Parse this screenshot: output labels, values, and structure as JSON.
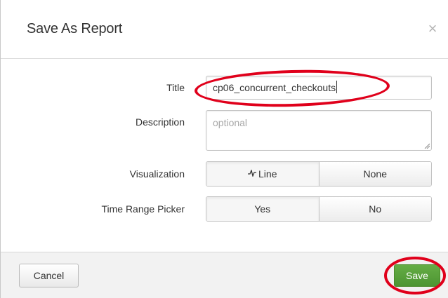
{
  "dialog": {
    "title": "Save As Report",
    "close_glyph": "×"
  },
  "form": {
    "title_label": "Title",
    "title_value": "cp06_concurrent_checkouts",
    "description_label": "Description",
    "description_placeholder": "optional",
    "visualization_label": "Visualization",
    "visualization_options": [
      {
        "label": "Line",
        "icon": "line-chart-icon",
        "selected": true
      },
      {
        "label": "None",
        "selected": false
      }
    ],
    "time_range_label": "Time Range Picker",
    "time_range_options": [
      {
        "label": "Yes",
        "selected": true
      },
      {
        "label": "No",
        "selected": false
      }
    ]
  },
  "footer": {
    "cancel_label": "Cancel",
    "save_label": "Save"
  },
  "colors": {
    "save_button": "#5ba33b",
    "annotation_circle": "#e0001b"
  }
}
